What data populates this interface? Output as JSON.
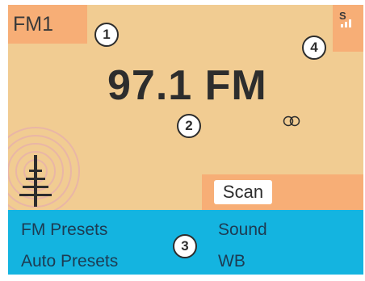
{
  "header": {
    "band_label": "FM1",
    "signal_label": "S"
  },
  "main": {
    "frequency": "97.1 FM",
    "stereo_icon": "stereo-icon",
    "scan_label": "Scan"
  },
  "menu": {
    "items": [
      {
        "label": "FM Presets"
      },
      {
        "label": "Sound"
      },
      {
        "label": "Auto Presets"
      },
      {
        "label": "WB"
      }
    ]
  },
  "callouts": [
    "1",
    "2",
    "3",
    "4"
  ],
  "colors": {
    "background": "#f1cc92",
    "accent": "#f7ae76",
    "menu_bar": "#14b4e0",
    "menu_text": "#1d3b52"
  }
}
